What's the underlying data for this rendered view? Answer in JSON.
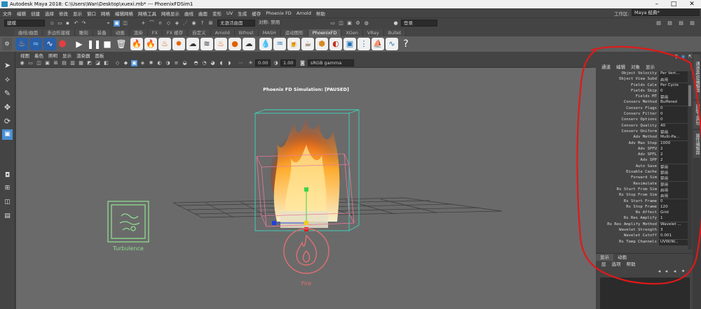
{
  "window": {
    "title": "Autodesk Maya 2018: C:\\Users\\Wan\\Desktop\\xuexi.mb*   ---   PhoenixFDSim1",
    "min": "–",
    "max": "□",
    "close": "✕"
  },
  "menubar": {
    "items": [
      "文件",
      "编辑",
      "创建",
      "选择",
      "修改",
      "显示",
      "窗口",
      "网格",
      "编辑网格",
      "网格工具",
      "网格显示",
      "曲线",
      "曲面",
      "变形",
      "UV",
      "生成",
      "缓存",
      "Phoenix FD",
      "Arnold",
      "帮助"
    ],
    "workspace_label": "工作区:",
    "workspace_value": "Maya 经典*"
  },
  "statusline": {
    "mode": "建模",
    "live_surface": "无激活曲面",
    "symmetry": "对称: 禁用",
    "login": "登录"
  },
  "shelf_tabs": [
    "曲线/曲面",
    "多边形建模",
    "雕刻",
    "装备",
    "动画",
    "渲染",
    "FX",
    "FX 缓存",
    "自定义",
    "Arnold",
    "Bifrost",
    "MASH",
    "运动图形",
    "PhoenixFD",
    "XGen",
    "VRay",
    "Bullet"
  ],
  "shelf_active_tab": "PhoenixFD",
  "viewport": {
    "menu": [
      "视图",
      "着色",
      "照明",
      "显示",
      "渲染器",
      "面板"
    ],
    "exposure": "0.00",
    "gamma": "1.00",
    "colorspace": "sRGB gamma",
    "overlay_title": "Phoenix FD Simulation: [PAUSED]",
    "turbulence_label": "Turbulence",
    "fire_label": "Fire"
  },
  "channel_box": {
    "menu": [
      "通道",
      "编辑",
      "对象",
      "显示"
    ],
    "attributes": [
      {
        "name": "Object Velocity",
        "value": "Per Vert..."
      },
      {
        "name": "Object View Subd",
        "value": "启用"
      },
      {
        "name": "Fields Cale",
        "value": "Per Cycle"
      },
      {
        "name": "Fields Skip",
        "value": "0"
      },
      {
        "name": "Fields MT",
        "value": "禁用"
      },
      {
        "name": "Conserv Method",
        "value": "Buffered"
      },
      {
        "name": "Conserv Flags",
        "value": "0"
      },
      {
        "name": "Conserv Filter",
        "value": "0"
      },
      {
        "name": "Conserv Options",
        "value": "0"
      },
      {
        "name": "Conserv Quality",
        "value": "40"
      },
      {
        "name": "Conserv Uniform",
        "value": "禁用"
      },
      {
        "name": "Adv Method",
        "value": "Multi-Pa..."
      },
      {
        "name": "Adv Max Step",
        "value": "1000"
      },
      {
        "name": "Adv SPFU",
        "value": "2"
      },
      {
        "name": "Adv SPFL",
        "value": "2"
      },
      {
        "name": "Adv SPP",
        "value": "2"
      },
      {
        "name": "Auto Save",
        "value": "禁用"
      },
      {
        "name": "Disable Cache",
        "value": "禁用"
      },
      {
        "name": "Forward Sim",
        "value": "禁用"
      },
      {
        "name": "Resimulate",
        "value": "禁用"
      },
      {
        "name": "Rs Start From Sim",
        "value": "启用"
      },
      {
        "name": "Rs Stop From Sim",
        "value": "启用"
      },
      {
        "name": "Rs Start Frame",
        "value": "0"
      },
      {
        "name": "Rs Stop Frame",
        "value": "120"
      },
      {
        "name": "Rs Affect",
        "value": "Grid"
      },
      {
        "name": "Rs Res Amplify",
        "value": "1"
      },
      {
        "name": "Rs Res Amplify Method",
        "value": "Wavelet ..."
      },
      {
        "name": "Wavelet Strength",
        "value": "3"
      },
      {
        "name": "Wavelet Cutoff",
        "value": "0.001"
      },
      {
        "name": "Rs Temp Channels",
        "value": "UVW/W..."
      }
    ],
    "side_tabs": [
      "通道盒/层编辑器",
      "建模工具包",
      "属性编辑器"
    ]
  },
  "layer_panel": {
    "tabs": [
      "显示",
      "动画"
    ],
    "menu": [
      "层",
      "选项",
      "帮助"
    ]
  },
  "colors": {
    "accent_blue": "#4a8fd6",
    "annotation_red": "#e01919",
    "turbulence_green": "#8fdc8f",
    "fire_red": "#e07070"
  }
}
